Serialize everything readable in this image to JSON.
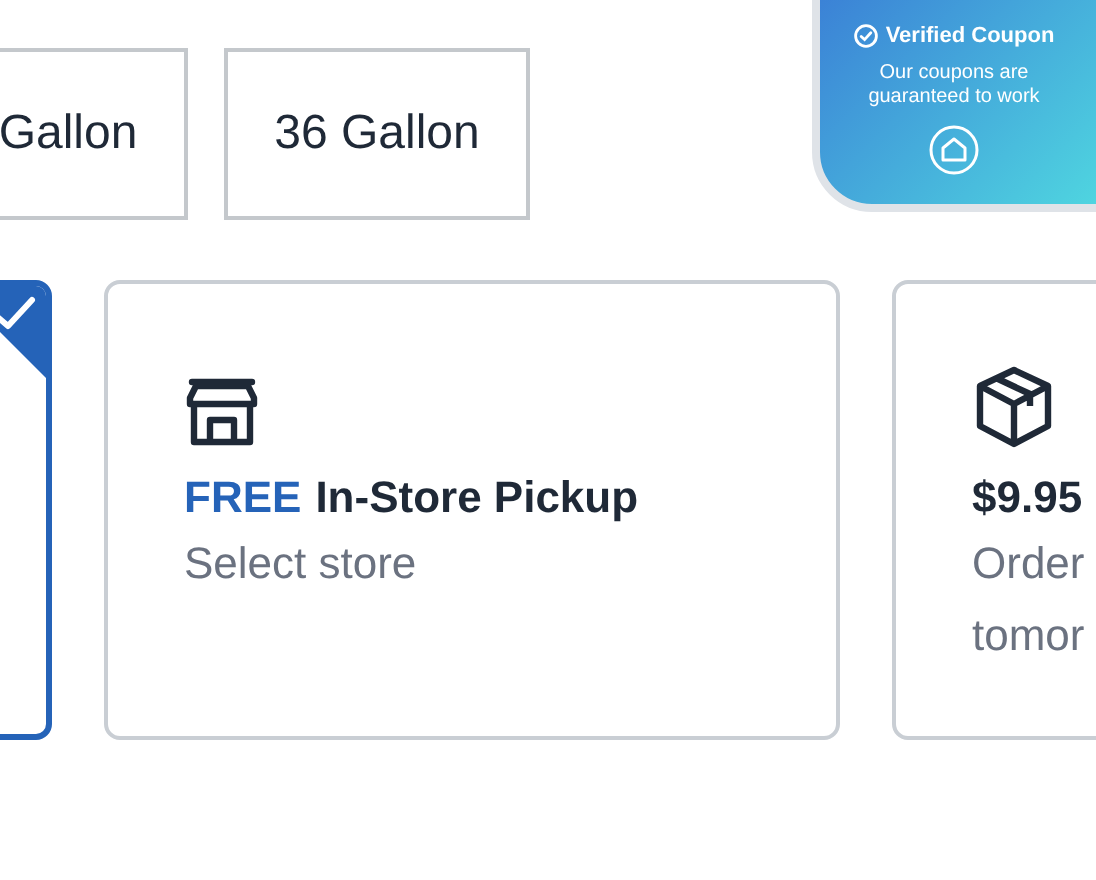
{
  "sizes": [
    {
      "label": "Gallon",
      "selected": false
    },
    {
      "label": "36 Gallon",
      "selected": false
    }
  ],
  "coupon": {
    "title": "Verified Coupon",
    "text": "Our coupons are guaranteed to work"
  },
  "options": [
    {
      "kind": "hidden",
      "selected": true
    },
    {
      "kind": "store",
      "selected": false,
      "highlight": "FREE",
      "title": "In-Store Pickup",
      "lines": [
        "Select store"
      ]
    },
    {
      "kind": "ship",
      "selected": false,
      "title": "$9.95",
      "lines": [
        "Order",
        "tomor"
      ]
    }
  ]
}
